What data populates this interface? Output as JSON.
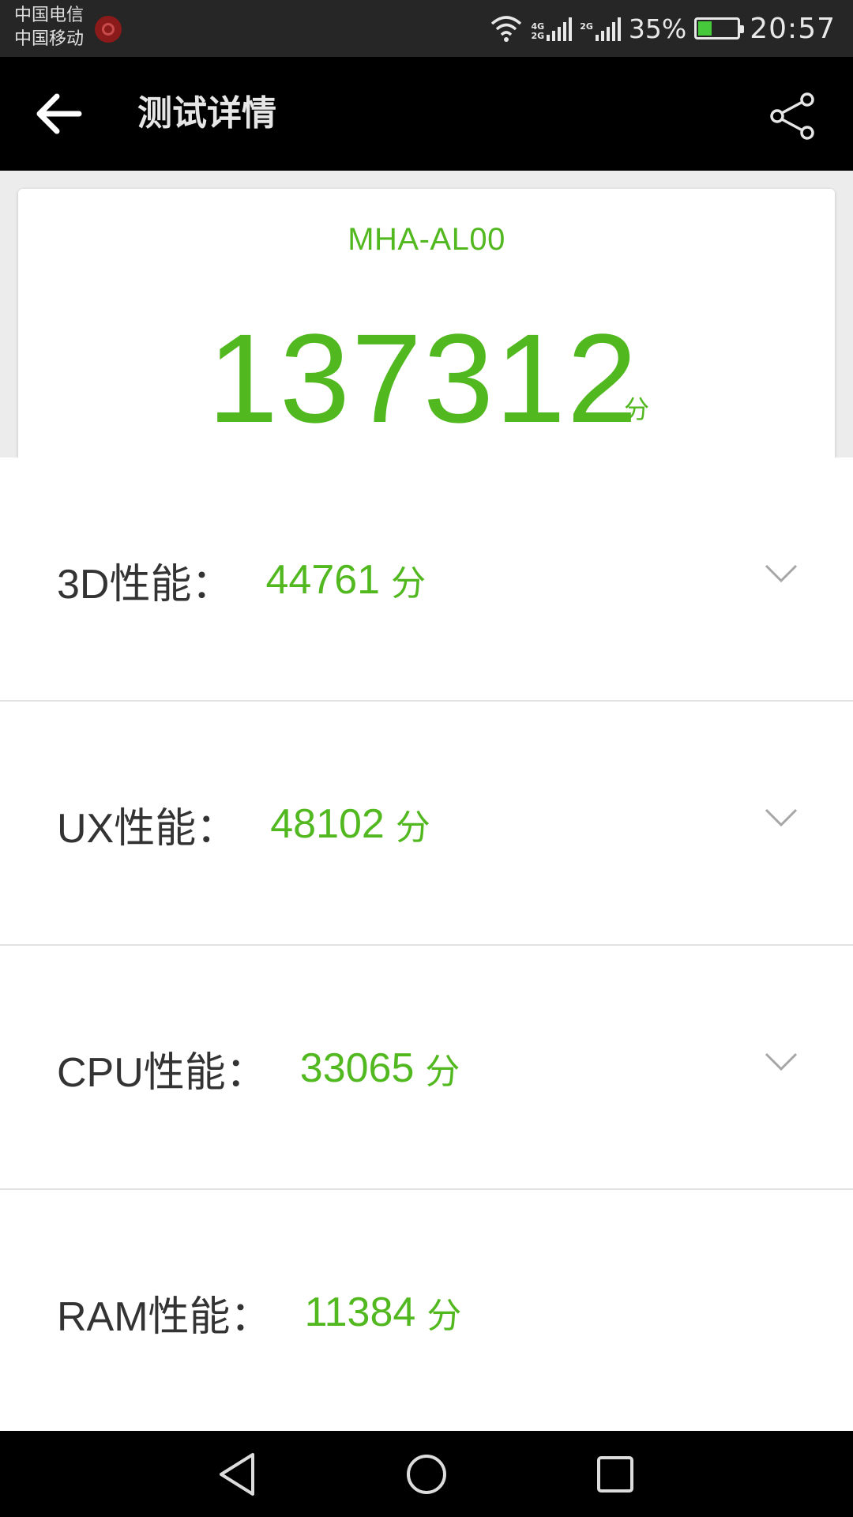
{
  "status_bar": {
    "carrier_1": "中国电信",
    "carrier_2": "中国移动",
    "network_1": [
      "4G",
      "2G"
    ],
    "network_2": "2G",
    "battery_percent": "35%",
    "battery_level": 0.35,
    "time": "20:57",
    "icons": [
      "carrier-badge-icon",
      "wifi-icon",
      "signal-icon",
      "battery-charging-icon"
    ]
  },
  "app_bar": {
    "title": "测试详情",
    "back_icon": "arrow-left-icon",
    "share_icon": "share-icon"
  },
  "score_card": {
    "device": "MHA-AL00",
    "total_score": "137312",
    "unit": "分"
  },
  "metrics": [
    {
      "label": "3D性能：",
      "value": "44761",
      "unit": "分",
      "expand_icon": "chevron-down-icon"
    },
    {
      "label": "UX性能：",
      "value": "48102",
      "unit": "分",
      "expand_icon": "chevron-down-icon"
    },
    {
      "label": "CPU性能：",
      "value": "33065",
      "unit": "分",
      "expand_icon": "chevron-down-icon"
    },
    {
      "label": "RAM性能：",
      "value": "11384",
      "unit": "分"
    }
  ],
  "nav_bar": {
    "icons": [
      "nav-back-icon",
      "nav-home-icon",
      "nav-recent-icon"
    ]
  },
  "colors": {
    "accent_green": "#52b81f",
    "status_bar": "#262626",
    "app_bar": "#000000",
    "background": "#ececec",
    "label_text": "#333333"
  }
}
